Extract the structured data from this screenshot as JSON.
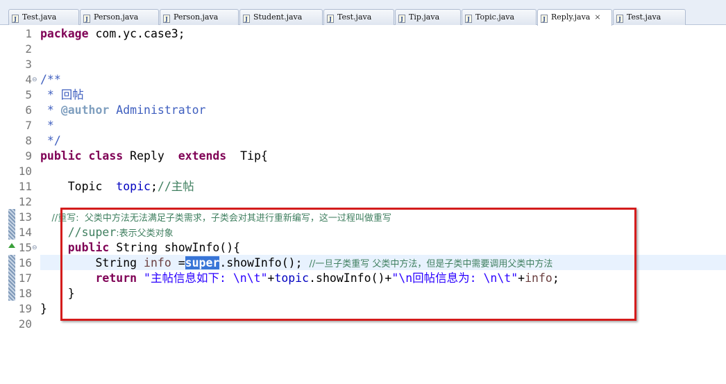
{
  "tabs": [
    {
      "label": "Test.java",
      "active": false
    },
    {
      "label": "Person.java",
      "active": false
    },
    {
      "label": "Person.java",
      "active": false
    },
    {
      "label": "Student.java",
      "active": false
    },
    {
      "label": "Test.java",
      "active": false
    },
    {
      "label": "Tip.java",
      "active": false
    },
    {
      "label": "Topic.java",
      "active": false
    },
    {
      "label": "Reply.java",
      "active": true
    },
    {
      "label": "Test.java",
      "active": false
    }
  ],
  "tab_file_icon_glyph": "J",
  "tab_close_glyph": "⨯",
  "line_numbers": [
    "1",
    "2",
    "3",
    "4",
    "5",
    "6",
    "7",
    "8",
    "9",
    "10",
    "11",
    "12",
    "13",
    "14",
    "15",
    "16",
    "17",
    "18",
    "19",
    "20"
  ],
  "code": {
    "l1_kw": "package",
    "l1_rest": " com.yc.case3;",
    "l4": "/**",
    "l5": " * 回帖",
    "l6_star": " * ",
    "l6_tag": "@author",
    "l6_name": " Administrator",
    "l7": " *",
    "l8": " */",
    "l9_kw1": "public",
    "l9_kw2": "class",
    "l9_name": " Reply  ",
    "l9_kw3": "extends",
    "l9_rest": "  Tip{",
    "l11_type": "    Topic  ",
    "l11_field": "topic",
    "l11_semi": ";",
    "l11_comment": "//主帖",
    "l13_comment": "    //重写:  父类中方法无法满足子类需求，子类会对其进行重新编写，这一过程叫做重写",
    "l14_c1": "    //super",
    "l14_c2": ":表示父类对象",
    "l15_indent": "    ",
    "l15_kw": "public",
    "l15_rest": " String showInfo(){",
    "l16_a": "        String ",
    "l16_var": "info",
    "l16_eq": " =",
    "l16_sel": "super",
    "l16_rest": ".showInfo(); ",
    "l16_comment": "//一旦子类重写 父类中方法，但是子类中需要调用父类中方法",
    "l17_indent": "        ",
    "l17_kw": "return",
    "l17_s1": " \"主帖信息如下: \\n\\t\"",
    "l17_plus1": "+",
    "l17_topic": "topic",
    "l17_mid": ".showInfo()+",
    "l17_s2": "\"\\n回帖信息为: \\n\\t\"",
    "l17_plus2": "+",
    "l17_info": "info",
    "l17_end": ";",
    "l18": "    }",
    "l19": "}"
  },
  "fold_glyph": "⊖"
}
